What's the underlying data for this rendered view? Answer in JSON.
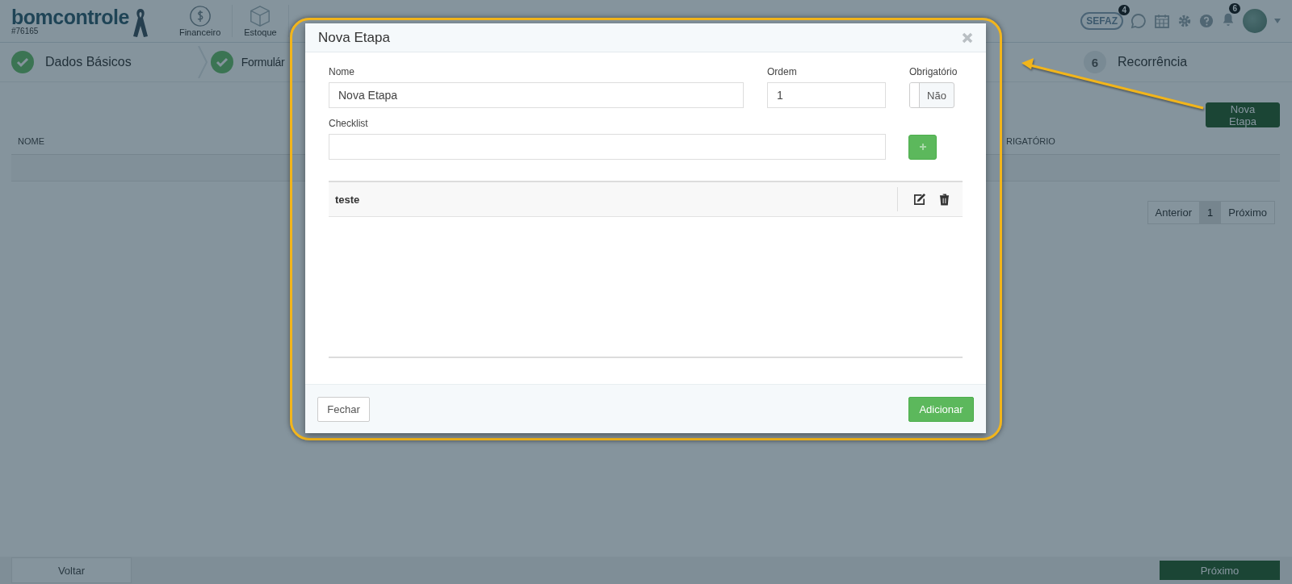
{
  "header": {
    "logo": "bomcontrole",
    "account": "#76165",
    "nav": [
      {
        "kind": "money",
        "label": "Financeiro"
      },
      {
        "kind": "box",
        "label": "Estoque"
      }
    ],
    "tools": [
      {
        "kind": "sefaz",
        "label": "SEFAZ",
        "count": "4"
      },
      {
        "kind": "whatsapp"
      },
      {
        "kind": "calendar"
      },
      {
        "kind": "gear"
      },
      {
        "kind": "help"
      },
      {
        "kind": "bell",
        "count": "6"
      },
      {
        "kind": "avatar"
      }
    ]
  },
  "steps": [
    {
      "done": true,
      "label": "Dados Básicos"
    },
    {
      "done": true,
      "label": "Formulár"
    },
    {
      "done": false,
      "number": "6",
      "label": "Recorrência"
    }
  ],
  "new_button": "Nova Etapa",
  "table": {
    "columns": [
      "NOME",
      "RIGATÓRIO"
    ]
  },
  "pagination": {
    "previous": "Anterior",
    "pages": [
      {
        "label": "1",
        "selected": true
      }
    ],
    "next": "Próximo"
  },
  "footer": {
    "back": "Voltar",
    "next": "Próximo"
  },
  "modal": {
    "title": "Nova Etapa",
    "fields": {
      "name": {
        "label": "Nome",
        "value": "Nova Etapa"
      },
      "order": {
        "label": "Ordem",
        "value": "1"
      },
      "required": {
        "label": "Obrigatório",
        "value_label": "Não",
        "on": false
      },
      "checklist": {
        "label": "Checklist"
      }
    },
    "checklist_items": [
      {
        "label": "teste"
      }
    ],
    "buttons": {
      "close": "Fechar",
      "add": "Adicionar"
    }
  }
}
